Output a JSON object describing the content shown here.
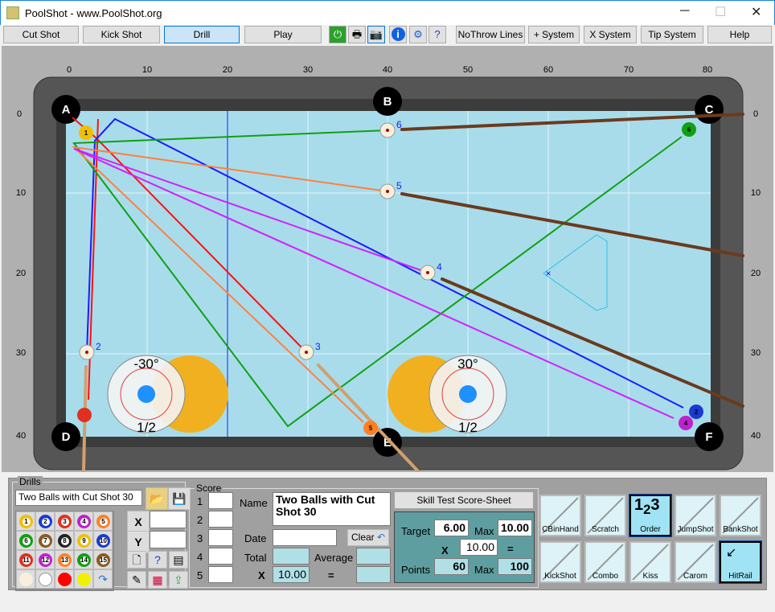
{
  "window": {
    "title": "PoolShot - www.PoolShot.org",
    "minimize": "─",
    "maximize": "☐",
    "close": "✕"
  },
  "toolbar": {
    "buttons": [
      "Cut Shot",
      "Kick Shot",
      "Drill",
      "Play"
    ],
    "selected": "Drill",
    "icons": [
      "power-icon",
      "printer-icon",
      "camera-icon",
      "info-icon",
      "gear-icon",
      "help-doc-icon"
    ],
    "right_buttons": [
      "NoThrow Lines",
      "+ System",
      "X System",
      "Tip System",
      "Help"
    ]
  },
  "table": {
    "x_ticks": [
      "0",
      "10",
      "20",
      "30",
      "40",
      "50",
      "60",
      "70",
      "80"
    ],
    "y_ticks": [
      "0",
      "10",
      "20",
      "30",
      "40"
    ],
    "pockets": [
      "A",
      "B",
      "C",
      "D",
      "E",
      "F"
    ],
    "ball_labels": [
      "6",
      "5",
      "4",
      "2",
      "3"
    ],
    "ghost_left": {
      "angle": "-30°",
      "fraction": "1/2"
    },
    "ghost_right": {
      "angle": "30°",
      "fraction": "1/2"
    },
    "colors": {
      "felt": "#a8dceb",
      "rail": "#5a5a5a",
      "red": "#ff1010",
      "blue": "#1a1aff",
      "green": "#10a010",
      "orange": "#ff8040",
      "magenta": "#d020ff"
    }
  },
  "drills": {
    "legend": "Drills",
    "name": "Two Balls with Cut Shot 30",
    "balls": [
      "1",
      "2",
      "3",
      "4",
      "5",
      "6",
      "7",
      "8",
      "9",
      "10",
      "11",
      "12",
      "13",
      "14",
      "15"
    ],
    "x_label": "X",
    "y_label": "Y",
    "x_value": "",
    "y_value": ""
  },
  "score": {
    "legend": "Score",
    "rows": [
      "1",
      "2",
      "3",
      "4",
      "5"
    ],
    "name_label": "Name",
    "name_value": "Two Balls with Cut Shot 30",
    "date_label": "Date",
    "date_value": "",
    "clear": "Clear",
    "total_label": "Total",
    "average_label": "Average",
    "x_label": "X",
    "multiplier": "10.00",
    "equals": "="
  },
  "skill": {
    "title": "Skill Test Score-Sheet",
    "target_label": "Target",
    "target": "6.00",
    "max_label": "Max",
    "max": "10.00",
    "x_label": "X",
    "multiplier": "10.00",
    "equals": "=",
    "points_label": "Points",
    "points": "60",
    "points_max": "100"
  },
  "shots": [
    {
      "label": "CBinHand",
      "active": false
    },
    {
      "label": "Scratch",
      "active": false
    },
    {
      "label": "Order",
      "active": true
    },
    {
      "label": "JumpShot",
      "active": false
    },
    {
      "label": "BankShot",
      "active": false
    },
    {
      "label": "KickShot",
      "active": false
    },
    {
      "label": "Combo",
      "active": false
    },
    {
      "label": "Kiss",
      "active": false
    },
    {
      "label": "Carom",
      "active": false
    },
    {
      "label": "HitRail",
      "active": true
    }
  ]
}
